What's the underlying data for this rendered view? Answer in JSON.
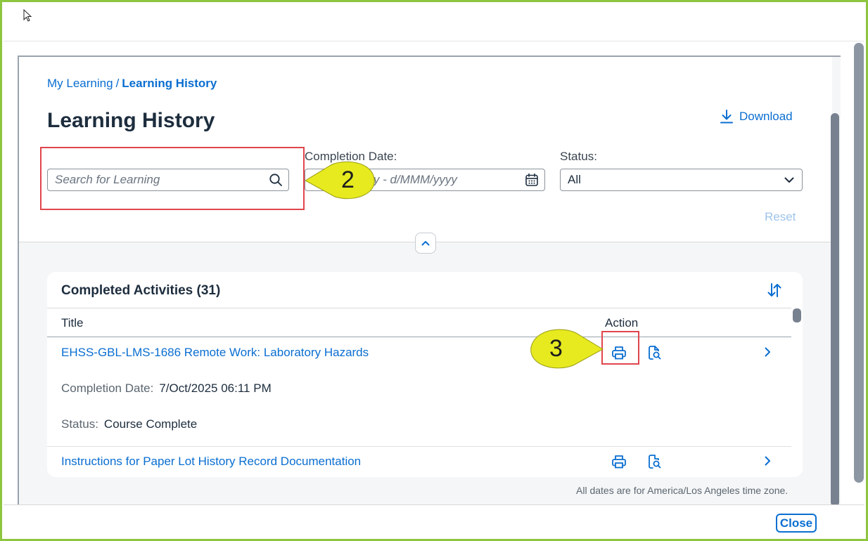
{
  "breadcrumb": {
    "parent": "My Learning",
    "separator": "/",
    "current": "Learning History"
  },
  "page": {
    "title": "Learning History",
    "download_label": "Download"
  },
  "filters": {
    "search_placeholder": "Search for Learning",
    "completion_date_label": "Completion Date:",
    "completion_date_placeholder": "d/MMM/yyyy - d/MMM/yyyy",
    "status_label": "Status:",
    "status_value": "All",
    "reset_label": "Reset"
  },
  "card": {
    "title": "Completed Activities (31)",
    "columns": {
      "title": "Title",
      "action": "Action"
    },
    "rows": [
      {
        "title": "EHSS-GBL-LMS-1686 Remote Work: Laboratory Hazards",
        "completion_label": "Completion Date:",
        "completion_value": "7/Oct/2025 06:11 PM",
        "status_label": "Status:",
        "status_value": "Course Complete"
      },
      {
        "title": "Instructions for Paper Lot History Record Documentation"
      }
    ]
  },
  "timezone_note": "All dates are for America/Los Angeles time zone.",
  "footer": {
    "close_label": "Close"
  },
  "callouts": {
    "search": "2",
    "print": "3"
  },
  "colors": {
    "accent": "#0a6ed1",
    "highlight": "#e0454c",
    "callout": "#e6ea1f",
    "frame": "#8dc63f"
  }
}
